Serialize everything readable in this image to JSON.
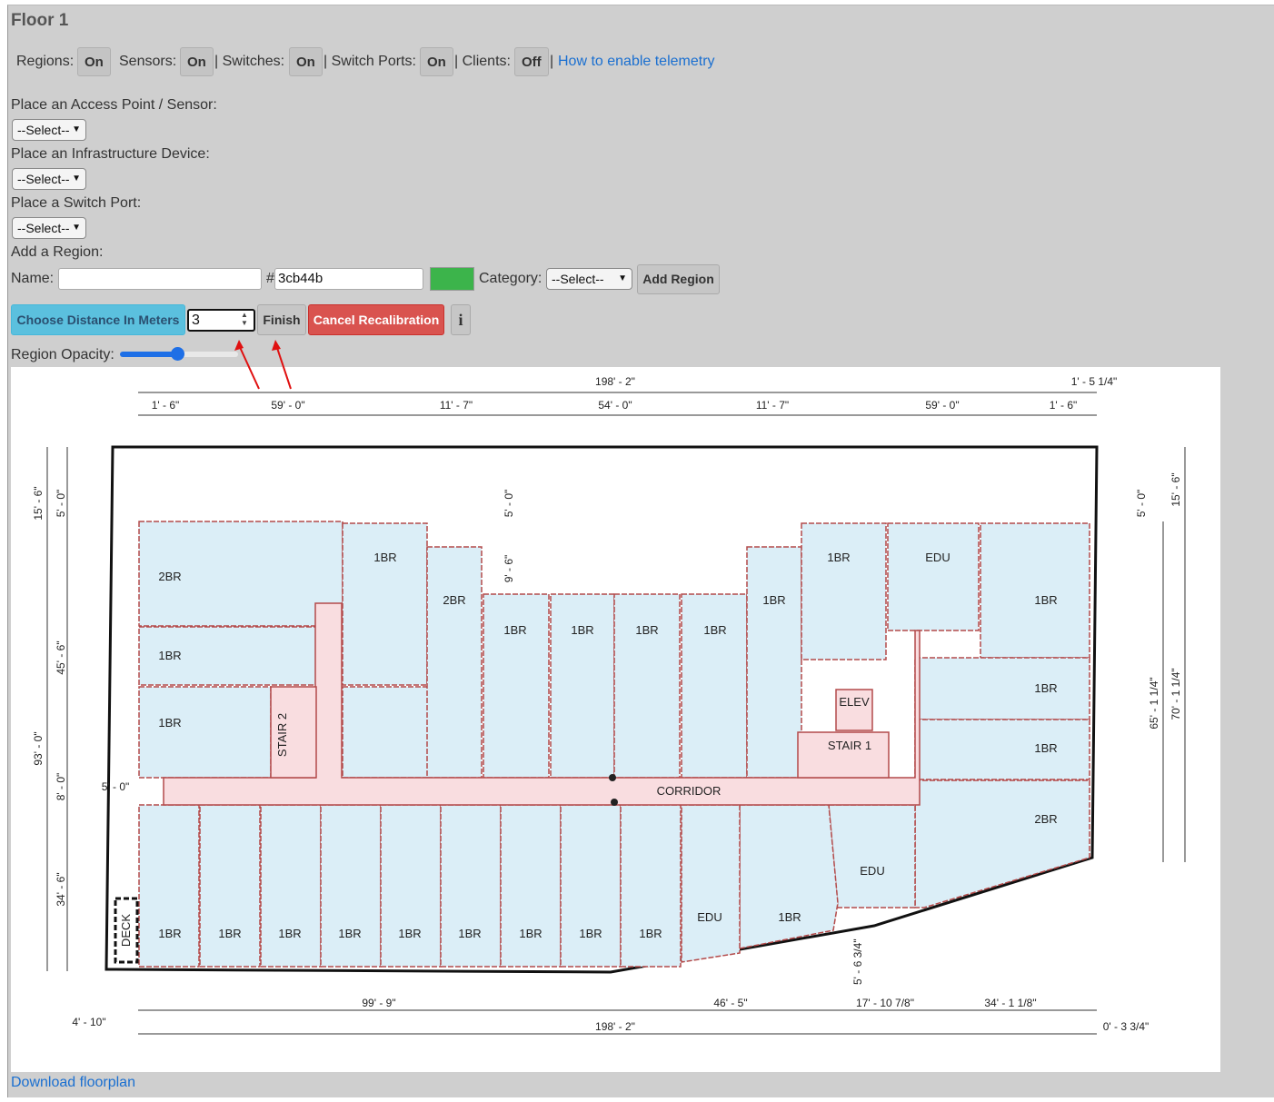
{
  "title": "Floor 1",
  "toggles": [
    {
      "label": "Regions:",
      "state": "On"
    },
    {
      "label": "Sensors:",
      "state": "On"
    },
    {
      "label": "| Switches:",
      "state": "On"
    },
    {
      "label": "| Switch Ports:",
      "state": "On"
    },
    {
      "label": "| Clients:",
      "state": "Off"
    }
  ],
  "separator": "|",
  "telemetry_link": "How to enable telemetry",
  "place_ap": {
    "label": "Place an Access Point / Sensor:",
    "value": "--Select--"
  },
  "place_infra": {
    "label": "Place an Infrastructure Device:",
    "value": "--Select--"
  },
  "place_port": {
    "label": "Place a Switch Port:",
    "value": "--Select--"
  },
  "add_region": {
    "label": "Add a Region:",
    "name_label": "Name:",
    "name_value": "",
    "hash": "#",
    "color_value": "3cb44b",
    "color": "#3cb44b",
    "category_label": "Category:",
    "category_value": "--Select--",
    "add_button": "Add Region"
  },
  "recalibration": {
    "choose_button": "Choose Distance In Meters",
    "distance_value": "3",
    "finish_button": "Finish",
    "cancel_button": "Cancel Recalibration",
    "info_button": "i"
  },
  "opacity": {
    "label": "Region Opacity:",
    "value_percent": 49
  },
  "download_link": "Download floorplan",
  "colors": {
    "accent_blue": "#5bc0de",
    "danger": "#d9534f",
    "link": "#1a6fd0",
    "room_fill": "#dbeef7",
    "corridor_fill": "#f9dde0"
  },
  "floorplan": {
    "dims_top": [
      "198' - 2\"",
      "1' - 5 1/4\"",
      "1' - 6\"",
      "59' - 0\"",
      "11' - 7\"",
      "54' - 0\"",
      "11' - 7\"",
      "59' - 0\"",
      "1' - 6\""
    ],
    "dims_bottom": [
      "99' - 9\"",
      "46' - 5\"",
      "17' - 10 7/8\"",
      "34' - 1 1/8\"",
      "198' - 2\"",
      "4' - 10\"",
      "0' - 3 3/4\"",
      "5' - 6 3/4\""
    ],
    "dims_left": [
      "15' - 6\"",
      "5' - 0\"",
      "45' - 6\"",
      "93' - 0\"",
      "8' - 0\"",
      "5' - 0\"",
      "34' - 6\""
    ],
    "dims_right": [
      "5' - 0\"",
      "15' - 6\"",
      "65' - 1 1/4\"",
      "70' - 1 1/4\""
    ],
    "dims_inner": [
      "5' - 0\"",
      "9' - 6\""
    ],
    "rooms": [
      "2BR",
      "1BR",
      "1BR",
      "STAIR 2",
      "1BR",
      "2BR",
      "1BR",
      "1BR",
      "1BR",
      "1BR",
      "1BR",
      "1BR",
      "EDU",
      "1BR",
      "ELEV",
      "STAIR 1",
      "1BR",
      "1BR",
      "CORRIDOR",
      "2BR",
      "EDU",
      "1BR",
      "EDU",
      "1BR",
      "1BR",
      "1BR",
      "1BR",
      "1BR",
      "1BR",
      "1BR",
      "1BR",
      "1BR",
      "DECK"
    ]
  }
}
